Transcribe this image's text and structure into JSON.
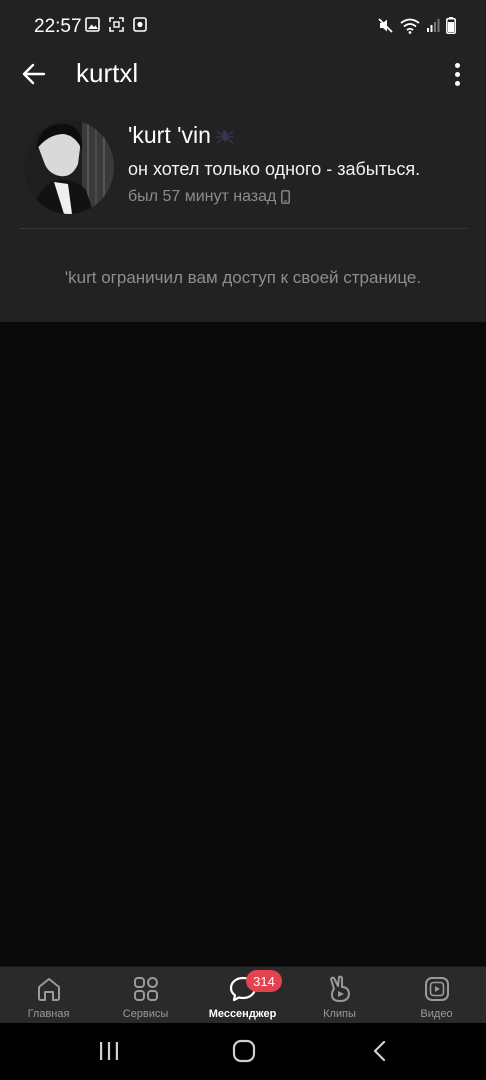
{
  "status_bar": {
    "time": "22:57"
  },
  "header": {
    "title": "kurtxl"
  },
  "profile": {
    "name": "'kurt 'vin",
    "status": "он хотел только одного - забыться.",
    "last_seen": "был 57 минут назад"
  },
  "notice": {
    "text": "'kurt ограничил вам доступ к своей странице."
  },
  "bottom_nav": {
    "items": [
      {
        "label": "Главная",
        "icon": "home-icon"
      },
      {
        "label": "Сервисы",
        "icon": "services-icon"
      },
      {
        "label": "Мессенджер",
        "icon": "messenger-icon",
        "active": true
      },
      {
        "label": "Клипы",
        "icon": "clips-icon"
      },
      {
        "label": "Видео",
        "icon": "video-icon"
      }
    ],
    "messenger_badge": "314"
  },
  "colors": {
    "panel": "#222222",
    "background": "#0a0a0a",
    "badge": "#e2434f",
    "muted_text": "#8e8e8e"
  }
}
